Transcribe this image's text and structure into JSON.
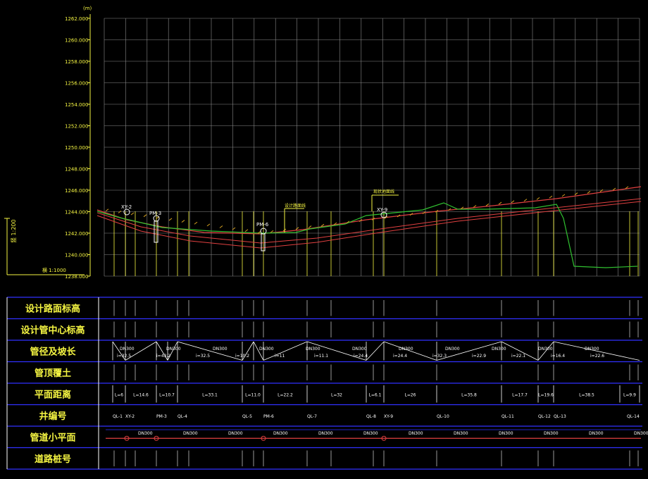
{
  "profile": {
    "y_unit": "(m)",
    "y_ticks": [
      "1262.000",
      "1260.000",
      "1258.000",
      "1256.000",
      "1254.000",
      "1252.000",
      "1250.000",
      "1248.000",
      "1246.000",
      "1244.000",
      "1242.000",
      "1240.000",
      "1238.000"
    ],
    "vertical_scale": "竖 1:200",
    "horizontal_scale": "横 1:1000",
    "wells": [
      {
        "label": "XY-2"
      },
      {
        "label": "PM-3"
      },
      {
        "label": "PM-6"
      },
      {
        "label": "XY-9"
      }
    ],
    "annotations": [
      "设计路面线",
      "现状地面线"
    ]
  },
  "table": {
    "rows": [
      {
        "label": "设计路面标高"
      },
      {
        "label": "设计管中心标高"
      },
      {
        "label": "管径及坡长"
      },
      {
        "label": "管顶覆土"
      },
      {
        "label": "平面距离"
      },
      {
        "label": "井编号"
      },
      {
        "label": "管道小平面"
      },
      {
        "label": "道路桩号"
      }
    ],
    "pipe_values": [
      "DN300",
      "DN300",
      "DN300",
      "DN300",
      "DN300",
      "DN300",
      "DN300",
      "DN300",
      "DN300",
      "DN300",
      "DN300"
    ],
    "slope_values": [
      "i=32.5",
      "i=43.2",
      "i=32.5",
      "i=10.2",
      "i=11",
      "i=11.1",
      "i=24.4",
      "i=24.4",
      "i=32.3",
      "i=22.9",
      "i=22.1",
      "i=16.4",
      "i=22.6"
    ],
    "distance_values": [
      "L=6",
      "L=14.6",
      "L=10.7",
      "L=33.1",
      "L=11.0",
      "L=22.2",
      "L=32",
      "L=6.1",
      "L=26",
      "L=35.8",
      "L=17.7",
      "L=19.6",
      "L=38.5",
      "L=9.9"
    ],
    "well_ids": [
      "QL-1",
      "XY-2",
      "PM-3",
      "QL-4",
      "QL-5",
      "PM-6",
      "QL-7",
      "QL-8",
      "XY-9",
      "QL-10",
      "QL-11",
      "QL-12",
      "QL-13",
      "QL-14"
    ],
    "plan_pipe_labels": [
      "DN300",
      "DN300",
      "DN300",
      "DN300",
      "DN300",
      "DN300",
      "DN300",
      "DN300",
      "DN300",
      "DN300",
      "DN300",
      "DN300"
    ]
  },
  "colors": {
    "grid": "#8a8a8a",
    "yellow": "#f5f542",
    "road": "#e04040",
    "ground": "#30c030",
    "table_border": "#3030ff",
    "white": "#ffffff"
  }
}
